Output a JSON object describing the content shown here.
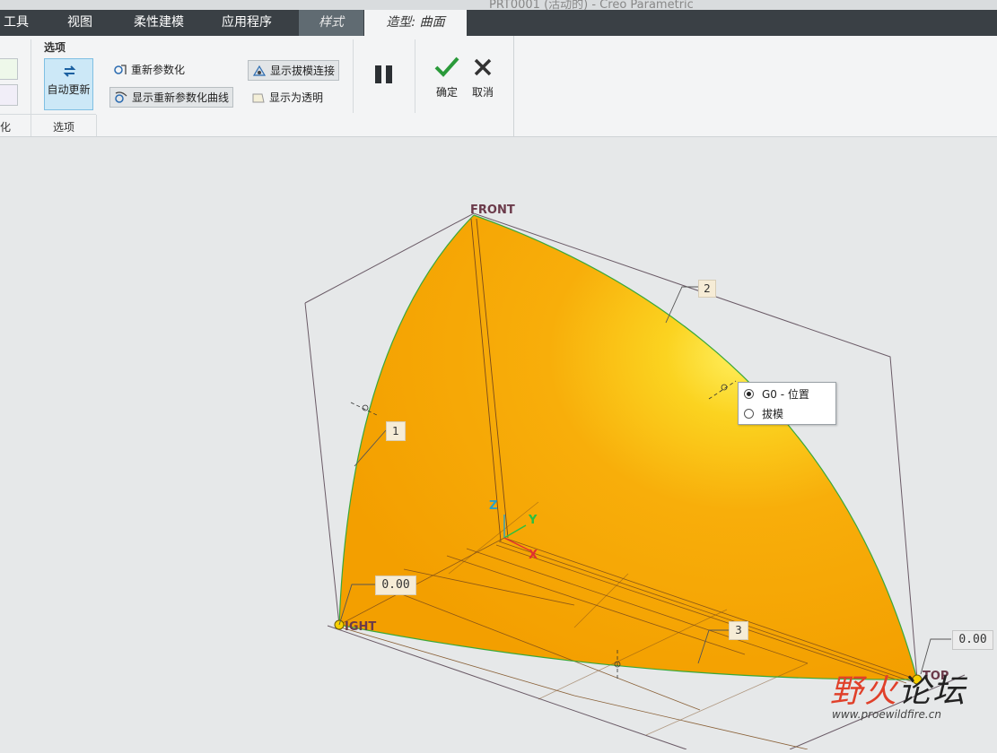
{
  "window": {
    "title": "PRT0001 (活动的) - Creo Parametric"
  },
  "tabs": [
    {
      "label": "工具",
      "state": "normal"
    },
    {
      "label": "视图",
      "state": "normal"
    },
    {
      "label": "柔性建模",
      "state": "normal"
    },
    {
      "label": "应用程序",
      "state": "normal"
    },
    {
      "label": "样式",
      "state": "styled"
    },
    {
      "label": "造型: 曲面",
      "state": "active"
    }
  ],
  "ribbon": {
    "left_group_label": "化",
    "options": {
      "header": "选项",
      "auto_update": "自动更新",
      "reparam": "重新参数化",
      "show_reparam_curves": "显示重新参数化曲线",
      "show_draft_conn": "显示拔模连接",
      "show_transparent": "显示为透明",
      "group_label": "选项"
    },
    "pause_icon": "pause-icon",
    "ok": "确定",
    "cancel": "取消",
    "colors": {
      "ok": "#2a9a3a",
      "cancel": "#333333"
    }
  },
  "viewport": {
    "datums": {
      "front": "FRONT",
      "right": "IGHT",
      "top": "TOP"
    },
    "axes": {
      "z": "Z",
      "y": "Y",
      "x": "X"
    },
    "curve_labels": [
      "1",
      "2",
      "3"
    ],
    "value_left": "0.00",
    "value_right": "0.00",
    "surface_color": "#f7a400",
    "edge_color": "#3aa83a"
  },
  "popup": {
    "options": [
      {
        "label": "G0 - 位置",
        "selected": true
      },
      {
        "label": "拔模",
        "selected": false
      }
    ]
  },
  "watermark": {
    "main_a": "野火",
    "main_b": "论坛",
    "url": "www.proewildfire.cn"
  }
}
